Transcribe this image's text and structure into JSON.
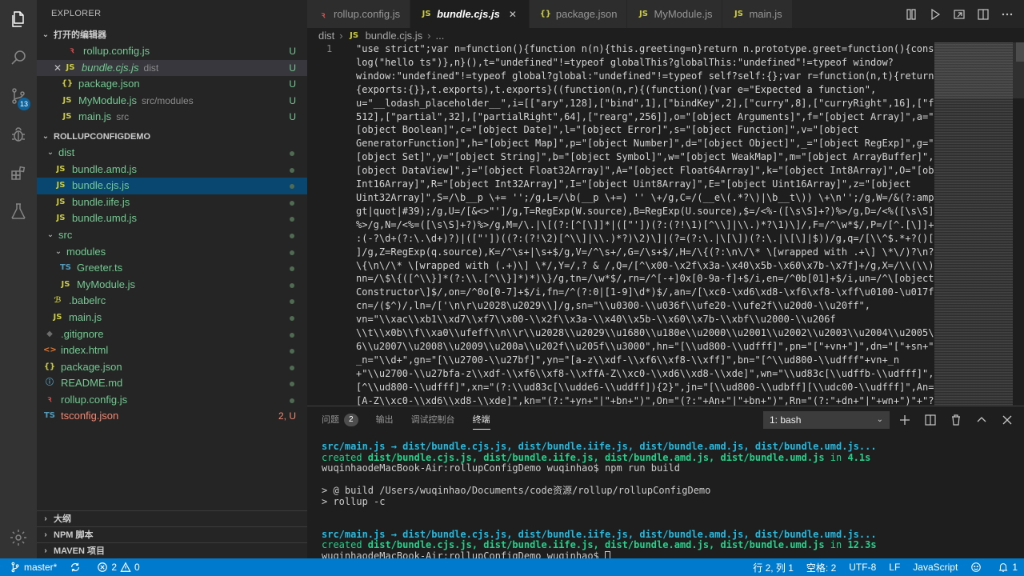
{
  "activity_bar": {
    "scm_badge": "13"
  },
  "sidebar": {
    "title": "EXPLORER",
    "open_editors": {
      "title": "打开的编辑器",
      "items": [
        {
          "icon": "rollup",
          "name": "rollup.config.js",
          "desc": "",
          "status": "U"
        },
        {
          "icon": "js",
          "name": "bundle.cjs.js",
          "desc": "dist",
          "status": "U"
        },
        {
          "icon": "json",
          "name": "package.json",
          "desc": "",
          "status": "U"
        },
        {
          "icon": "js",
          "name": "MyModule.js",
          "desc": "src/modules",
          "status": "U"
        },
        {
          "icon": "js",
          "name": "main.js",
          "desc": "src",
          "status": "U"
        }
      ]
    },
    "project": {
      "title": "ROLLUPCONFIGDEMO",
      "items": [
        {
          "name": "dist",
          "type": "folder"
        },
        {
          "name": "bundle.amd.js"
        },
        {
          "name": "bundle.cjs.js"
        },
        {
          "name": "bundle.iife.js"
        },
        {
          "name": "bundle.umd.js"
        },
        {
          "name": "src",
          "type": "folder"
        },
        {
          "name": "modules",
          "type": "folder"
        },
        {
          "name": "Greeter.ts"
        },
        {
          "name": "MyModule.js"
        },
        {
          "name": ".babelrc"
        },
        {
          "name": "main.js"
        },
        {
          "name": ".gitignore"
        },
        {
          "name": "index.html"
        },
        {
          "name": "package.json"
        },
        {
          "name": "README.md"
        },
        {
          "name": "rollup.config.js"
        },
        {
          "name": "tsconfig.json",
          "status": "2, U"
        }
      ]
    },
    "bottom_sections": [
      "大纲",
      "NPM 脚本",
      "MAVEN 项目"
    ]
  },
  "tabs": [
    {
      "icon": "rollup",
      "label": "rollup.config.js",
      "active": false
    },
    {
      "icon": "js",
      "label": "bundle.cjs.js",
      "active": true
    },
    {
      "icon": "json",
      "label": "package.json",
      "active": false
    },
    {
      "icon": "js",
      "label": "MyModule.js",
      "active": false
    },
    {
      "icon": "js",
      "label": "main.js",
      "active": false
    }
  ],
  "breadcrumb": {
    "folder": "dist",
    "file": "bundle.cjs.js",
    "more": "..."
  },
  "editor": {
    "line_number": "1",
    "code_lines": [
      "\"use strict\";var n=function(){function n(n){this.greeting=n}return n.prototype.greet=function(){console.",
      "log(\"hello ts\")},n}(),t=\"undefined\"!=typeof globalThis?globalThis:\"undefined\"!=typeof window?",
      "window:\"undefined\"!=typeof global?global:\"undefined\"!=typeof self?self:{};var r=function(n,t){return n(t=",
      "{exports:{}},t.exports),t.exports}((function(n,r){(function(){var e=\"Expected a function\",",
      "u=\"__lodash_placeholder__\",i=[[\"ary\",128],[\"bind\",1],[\"bindKey\",2],[\"curry\",8],[\"curryRight\",16],[\"flip\",",
      "512],[\"partial\",32],[\"partialRight\",64],[\"rearg\",256]],o=\"[object Arguments]\",f=\"[object Array]\",a=\"",
      "[object Boolean]\",c=\"[object Date]\",l=\"[object Error]\",s=\"[object Function]\",v=\"[object",
      "GeneratorFunction]\",h=\"[object Map]\",p=\"[object Number]\",d=\"[object Object]\",_=\"[object RegExp]\",g=\"",
      "[object Set]\",y=\"[object String]\",b=\"[object Symbol]\",w=\"[object WeakMap]\",m=\"[object ArrayBuffer]\",x=\"",
      "[object DataView]\",j=\"[object Float32Array]\",A=\"[object Float64Array]\",k=\"[object Int8Array]\",O=\"[object",
      "Int16Array]\",R=\"[object Int32Array]\",I=\"[object Uint8Array]\",E=\"[object Uint16Array]\",z=\"[object",
      "Uint32Array]\",S=/\\b__p \\+= '';/g,L=/\\b(__p \\+=) '' \\+/g,C=/(__e\\(.*?\\)|\\b__t\\)) \\+\\n'';/g,W=/&(?:amp|lt|",
      "gt|quot|#39);/g,U=/[&<>\"']/g,T=RegExp(W.source),B=RegExp(U.source),$=/<%-([\\s\\S]+?)%>/g,D=/<%([\\s\\S]+?)",
      "%>/g,N=/<%=([\\s\\S]+?)%>/g,M=/\\.|\\[(?:[^[\\]]*|([\"'])(?:(?!\\1)[^\\\\]|\\\\.)*?\\1)\\]/,F=/^\\w*$/,P=/[^.[\\]]+|\\[(?",
      ":(-?\\d+(?:\\.\\d+)?)|([\"'])((?:(?!\\2)[^\\\\]|\\\\.)*?)\\2)\\]|(?=(?:\\.|\\[\\])(?:\\.|\\[\\]|$))/g,q=/[\\\\^$.*+?()[\\]{}|",
      "]/g,Z=RegExp(q.source),K=/^\\s+|\\s+$/g,V=/^\\s+/,G=/\\s+$/,H=/\\{(?:\\n\\/\\* \\[wrapped with .+\\] \\*\\/)?\\n?/,J=/",
      "\\{\\n\\/\\* \\[wrapped with (.+)\\] \\*/,Y=/,? & /,Q=/[^\\x00-\\x2f\\x3a-\\x40\\x5b-\\x60\\x7b-\\x7f]+/g,X=/\\\\(\\\\)?/g,",
      "nn=/\\$\\{([^\\\\}]*(?:\\\\.[^\\\\}]*)*)\\}/g,tn=/\\w*$/,rn=/^[-+]0x[0-9a-f]+$/i,en=/^0b[01]+$/i,un=/^\\[object .+?",
      "Constructor\\]$/,on=/^0o[0-7]+$/i,fn=/^(?:0|[1-9]\\d*)$/,an=/[\\xc0-\\xd6\\xd8-\\xf6\\xf8-\\xff\\u0100-\\u017f]/g,",
      "cn=/($^)/,ln=/['\\n\\r\\u2028\\u2029\\\\]/g,sn=\"\\\\u0300-\\\\u036f\\\\ufe20-\\\\ufe2f\\\\u20d0-\\\\u20ff\",",
      "vn=\"\\\\xac\\\\xb1\\\\xd7\\\\xf7\\\\x00-\\\\x2f\\\\x3a-\\\\x40\\\\x5b-\\\\x60\\\\x7b-\\\\xbf\\\\u2000-\\\\u206f",
      "\\\\t\\\\x0b\\\\f\\\\xa0\\\\ufeff\\\\n\\\\r\\\\u2028\\\\u2029\\\\u1680\\\\u180e\\\\u2000\\\\u2001\\\\u2002\\\\u2003\\\\u2004\\\\u2005\\\\u200",
      "6\\\\u2007\\\\u2008\\\\u2009\\\\u200a\\\\u202f\\\\u205f\\\\u3000\",hn=\"[\\\\ud800-\\\\udfff]\",pn=\"[\"+vn+\"]\",dn=\"[\"+sn+\"]\",",
      "_n=\"\\\\d+\",gn=\"[\\\\u2700-\\\\u27bf]\",yn=\"[a-z\\\\xdf-\\\\xf6\\\\xf8-\\\\xff]\",bn=\"[^\\\\ud800-\\\\udfff\"+vn+_n",
      "+\"\\\\u2700-\\\\u27bfa-z\\\\xdf-\\\\xf6\\\\xf8-\\\\xffA-Z\\\\xc0-\\\\xd6\\\\xd8-\\\\xde]\",wn=\"\\\\ud83c[\\\\udffb-\\\\udfff]\",mn=\"",
      "[^\\\\ud800-\\\\udfff]\",xn=\"(?:\\\\ud83c[\\\\udde6-\\\\uddff]){2}\",jn=\"[\\\\ud800-\\\\udbff][\\\\udc00-\\\\udfff]\",An=\"",
      "[A-Z\\\\xc0-\\\\xd6\\\\xd8-\\\\xde]\",kn=\"(?:\"+yn+\"|\"+bn+\")\",On=\"(?:\"+An+\"|\"+bn+\")\",Rn=\"(?:\"+dn+\"|\"+wn+\")\"+\"?\","
    ]
  },
  "panel": {
    "tabs": [
      {
        "label": "问题",
        "count": "2",
        "active": false
      },
      {
        "label": "输出",
        "active": false
      },
      {
        "label": "调试控制台",
        "active": false
      },
      {
        "label": "终端",
        "active": true
      }
    ],
    "terminal_select": "1: bash",
    "terminal": {
      "block1_line1": "src/main.js → dist/bundle.cjs.js, dist/bundle.iife.js, dist/bundle.amd.js, dist/bundle.umd.js...",
      "block1_created": "created ",
      "block1_files": "dist/bundle.cjs.js, dist/bundle.iife.js, dist/bundle.amd.js, dist/bundle.umd.js",
      "block1_in": " in ",
      "block1_time": "4.1s",
      "prompt1": "wuqinhaodeMacBook-Air:rollupConfigDemo wuqinhao$ npm run build",
      "build1": "> @ build /Users/wuqinhao/Documents/code资源/rollup/rollupConfigDemo",
      "build2": "> rollup -c",
      "block2_line1": "src/main.js → dist/bundle.cjs.js, dist/bundle.iife.js, dist/bundle.amd.js, dist/bundle.umd.js...",
      "block2_created": "created ",
      "block2_files": "dist/bundle.cjs.js, dist/bundle.iife.js, dist/bundle.amd.js, dist/bundle.umd.js",
      "block2_in": " in ",
      "block2_time": "12.3s",
      "prompt2": "wuqinhaodeMacBook-Air:rollupConfigDemo wuqinhao$ "
    }
  },
  "status_bar": {
    "branch": "master*",
    "errors": "2",
    "warnings": "0",
    "position": "行 2, 列 1",
    "spaces": "空格: 2",
    "encoding": "UTF-8",
    "eol": "LF",
    "language": "JavaScript",
    "notifications": "1"
  }
}
